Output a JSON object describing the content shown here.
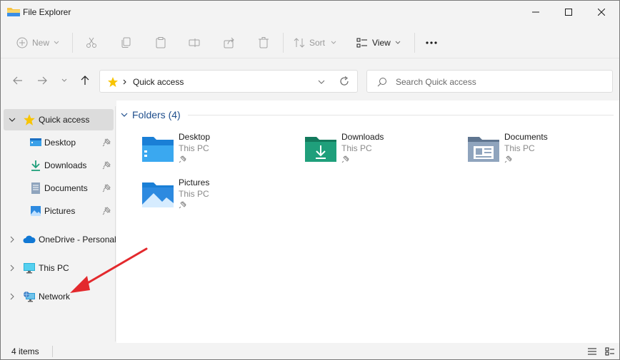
{
  "window": {
    "title": "File Explorer"
  },
  "toolbar": {
    "new_label": "New",
    "sort_label": "Sort",
    "view_label": "View"
  },
  "address": {
    "location": "Quick access"
  },
  "search": {
    "placeholder": "Search Quick access"
  },
  "sidebar": {
    "items": [
      {
        "label": "Quick access",
        "icon": "star-icon"
      },
      {
        "label": "Desktop",
        "icon": "desktop-icon"
      },
      {
        "label": "Downloads",
        "icon": "download-icon"
      },
      {
        "label": "Documents",
        "icon": "documents-icon"
      },
      {
        "label": "Pictures",
        "icon": "pictures-icon"
      },
      {
        "label": "OneDrive - Personal",
        "icon": "cloud-icon"
      },
      {
        "label": "This PC",
        "icon": "computer-icon"
      },
      {
        "label": "Network",
        "icon": "network-icon"
      }
    ]
  },
  "content": {
    "group_title": "Folders (4)",
    "folders": [
      {
        "name": "Desktop",
        "location": "This PC",
        "icon": "desktop-folder-icon"
      },
      {
        "name": "Downloads",
        "location": "This PC",
        "icon": "downloads-folder-icon"
      },
      {
        "name": "Documents",
        "location": "This PC",
        "icon": "documents-folder-icon"
      },
      {
        "name": "Pictures",
        "location": "This PC",
        "icon": "pictures-folder-icon"
      }
    ]
  },
  "status": {
    "item_count": "4 items"
  },
  "colors": {
    "accent": "#0067c0",
    "star": "#f8c400",
    "arrow": "#e3292d",
    "downloads_folder": "#1f9f7b"
  }
}
